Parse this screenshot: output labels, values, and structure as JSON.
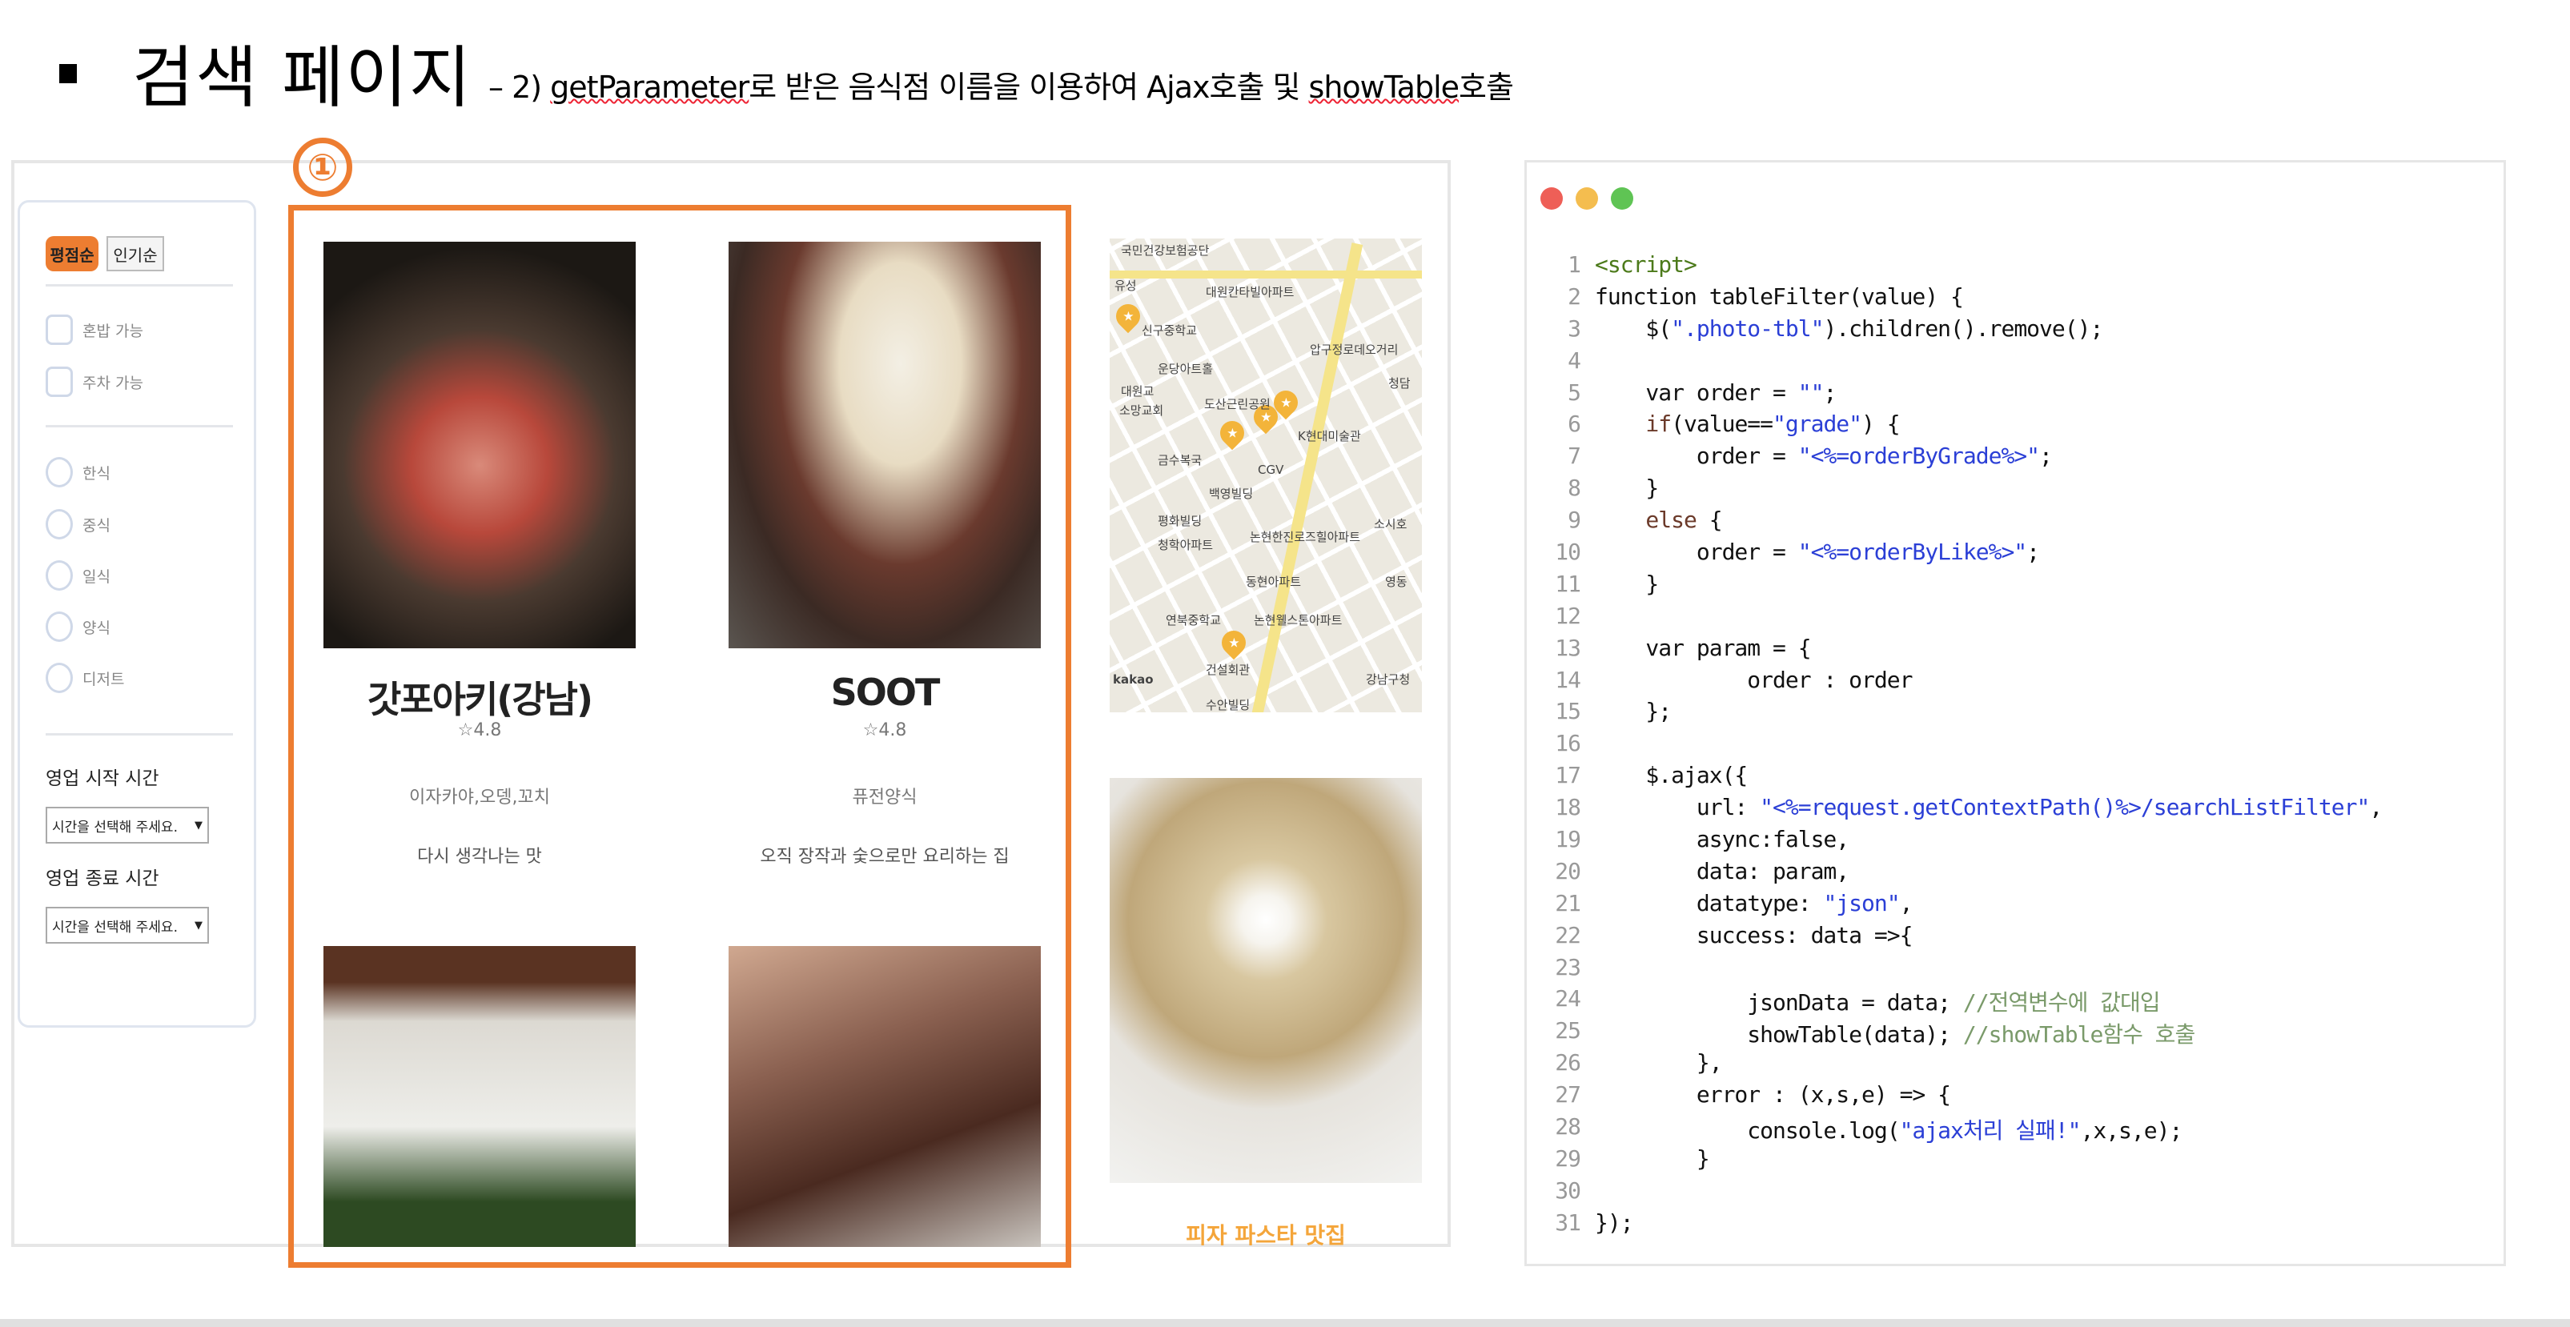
{
  "slide": {
    "title": "검색 페이지",
    "subtitle_prefix": "– 2) ",
    "subtitle_u1": "getParameter",
    "subtitle_mid": "로 받은 음식점 이름을 이용하여 Ajax호출 및 ",
    "subtitle_u2": "showTable",
    "subtitle_end": "호출",
    "marker": "①"
  },
  "sidebar": {
    "sort_grade": "평점순",
    "sort_like": "인기순",
    "checkboxes": [
      "혼밥 가능",
      "주차 가능"
    ],
    "radios": [
      "한식",
      "중식",
      "일식",
      "양식",
      "디저트"
    ],
    "open_label": "영업 시작 시간",
    "open_select": "시간을 선택해 주세요.",
    "close_label": "영업 종료 시간",
    "close_select": "시간을 선택해 주세요."
  },
  "cards": [
    {
      "name": "갓포아키(강남)",
      "rating": "☆4.8",
      "category": "이자카야,오뎅,꼬치",
      "desc": "다시 생각나는 맛"
    },
    {
      "name": "SOOT",
      "rating": "☆4.8",
      "category": "퓨전양식",
      "desc": "오직 장작과 숯으로만 요리하는 집"
    }
  ],
  "map": {
    "labels": [
      "국민건강보험공단",
      "유성",
      "신구중학교",
      "대원칸타빌아파트",
      "압구정로데오거리",
      "운당아트홀",
      "대원교",
      "소망교회",
      "도산근린공원",
      "K현대미술관",
      "금수복국",
      "CGV",
      "백영빌딩",
      "평화빌딩",
      "청학아파트",
      "논현한진로즈힐아파트",
      "동현아파트",
      "연북중학교",
      "논현웰스톤아파트",
      "건설회관",
      "수안빌딩",
      "강남구청",
      "kakao",
      "소시호",
      "청담",
      "영동"
    ]
  },
  "pasta_label": "피자 파스타 맛집",
  "code_colors": {
    "close": "#ee5f57",
    "min": "#f4bd4f",
    "max": "#5fc454"
  },
  "code": [
    [
      [
        "tag",
        "<script>"
      ]
    ],
    [
      [
        "plain",
        "function tableFilter(value) {"
      ]
    ],
    [
      [
        "plain",
        "    $("
      ],
      [
        "str",
        "\".photo-tbl\""
      ],
      [
        "plain",
        ").children().remove();"
      ]
    ],
    [],
    [
      [
        "plain",
        "    var order = "
      ],
      [
        "str",
        "\"\""
      ],
      [
        "plain",
        ";"
      ]
    ],
    [
      [
        "kw",
        "    if"
      ],
      [
        "plain",
        "(value=="
      ],
      [
        "str",
        "\"grade\""
      ],
      [
        "plain",
        ") {"
      ]
    ],
    [
      [
        "plain",
        "        order = "
      ],
      [
        "str",
        "\"<%=orderByGrade%>\""
      ],
      [
        "plain",
        ";"
      ]
    ],
    [
      [
        "plain",
        "    }"
      ]
    ],
    [
      [
        "kw",
        "    else"
      ],
      [
        "plain",
        " {"
      ]
    ],
    [
      [
        "plain",
        "        order = "
      ],
      [
        "str",
        "\"<%=orderByLike%>\""
      ],
      [
        "plain",
        ";"
      ]
    ],
    [
      [
        "plain",
        "    }"
      ]
    ],
    [],
    [
      [
        "plain",
        "    var param = {"
      ]
    ],
    [
      [
        "plain",
        "            order : order"
      ]
    ],
    [
      [
        "plain",
        "    };"
      ]
    ],
    [],
    [
      [
        "plain",
        "    $.ajax({"
      ]
    ],
    [
      [
        "plain",
        "        url: "
      ],
      [
        "str",
        "\"<%=request.getContextPath()%>/searchListFilter\""
      ],
      [
        "plain",
        ","
      ]
    ],
    [
      [
        "plain",
        "        async:false,"
      ]
    ],
    [
      [
        "plain",
        "        data: param,"
      ]
    ],
    [
      [
        "plain",
        "        datatype: "
      ],
      [
        "str",
        "\"json\""
      ],
      [
        "plain",
        ","
      ]
    ],
    [
      [
        "plain",
        "        success: data =>{"
      ]
    ],
    [],
    [
      [
        "plain",
        "            jsonData = data; "
      ],
      [
        "cm",
        "//전역변수에 값대입"
      ]
    ],
    [
      [
        "plain",
        "            showTable(data); "
      ],
      [
        "cm",
        "//showTable함수 호출"
      ]
    ],
    [
      [
        "plain",
        "        },"
      ]
    ],
    [
      [
        "plain",
        "        error : (x,s,e) => {"
      ]
    ],
    [
      [
        "plain",
        "            console.log("
      ],
      [
        "str",
        "\"ajax처리 실패!\""
      ],
      [
        "plain",
        ",x,s,e);"
      ]
    ],
    [
      [
        "plain",
        "        }"
      ]
    ],
    [],
    [
      [
        "plain",
        "});"
      ]
    ]
  ]
}
